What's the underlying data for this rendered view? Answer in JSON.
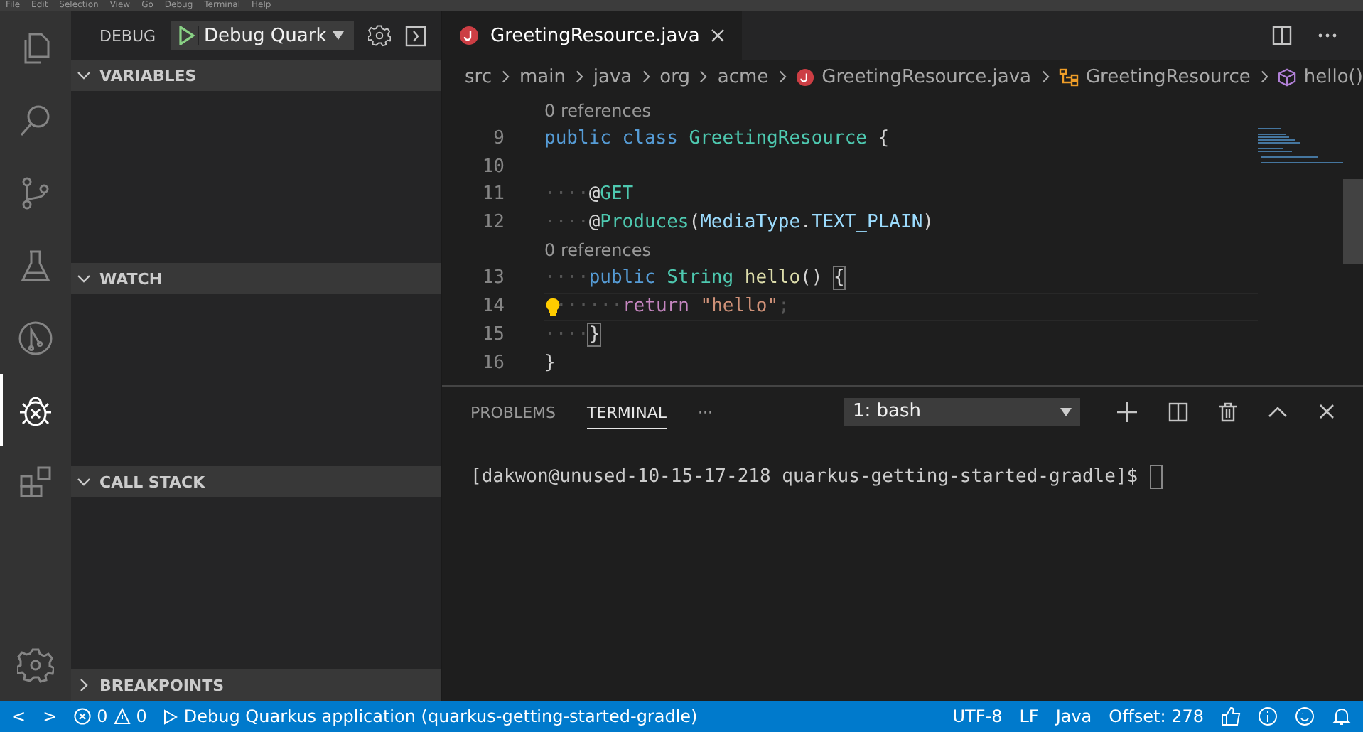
{
  "menu_bar": [
    "File",
    "Edit",
    "Selection",
    "View",
    "Go",
    "Debug",
    "Terminal",
    "Help"
  ],
  "activity_bar": [
    {
      "kind": "files",
      "selected": false
    },
    {
      "kind": "search",
      "selected": false
    },
    {
      "kind": "branch",
      "selected": false
    },
    {
      "kind": "flask",
      "selected": false
    },
    {
      "kind": "graph",
      "selected": false
    },
    {
      "kind": "bug",
      "selected": true
    },
    {
      "kind": "blocks",
      "selected": false
    }
  ],
  "debug_toolbar": {
    "title": "DEBUG",
    "configuration": "Debug Quark"
  },
  "sidebar_sections": [
    {
      "title": "VARIABLES",
      "expanded": true
    },
    {
      "title": "WATCH",
      "expanded": true
    },
    {
      "title": "CALL STACK",
      "expanded": true
    },
    {
      "title": "BREAKPOINTS",
      "expanded": false
    }
  ],
  "editor_tabs": [
    {
      "label": "GreetingResource.java",
      "selected": true
    }
  ],
  "breadcrumbs": [
    {
      "label": "src",
      "kind": "folder"
    },
    {
      "label": "main",
      "kind": "folder"
    },
    {
      "label": "java",
      "kind": "folder"
    },
    {
      "label": "org",
      "kind": "folder"
    },
    {
      "label": "acme",
      "kind": "folder"
    },
    {
      "label": "GreetingResource.java",
      "kind": "java"
    },
    {
      "label": "GreetingResource",
      "kind": "class"
    },
    {
      "label": "hello()",
      "kind": "method"
    }
  ],
  "code_lines": [
    {
      "kind": "lens",
      "text": "0 references"
    },
    {
      "kind": "code",
      "number": "9",
      "current": false,
      "lightbulb": false,
      "tokens": [
        {
          "kind": "kw",
          "text": "public class "
        },
        {
          "kind": "type",
          "text": "GreetingResource"
        },
        {
          "kind": "plain",
          "text": " {"
        }
      ]
    },
    {
      "kind": "code",
      "number": "10",
      "current": false,
      "lightbulb": false
    },
    {
      "kind": "code",
      "number": "11",
      "current": false,
      "lightbulb": false,
      "tokens": [
        {
          "kind": "ws",
          "text": "····"
        },
        {
          "kind": "plain",
          "text": "@"
        },
        {
          "kind": "type",
          "text": "GET"
        }
      ]
    },
    {
      "kind": "code",
      "number": "12",
      "current": false,
      "lightbulb": false,
      "tokens": [
        {
          "kind": "ws",
          "text": "····"
        },
        {
          "kind": "plain",
          "text": "@"
        },
        {
          "kind": "type",
          "text": "Produces"
        },
        {
          "kind": "plain",
          "text": "("
        },
        {
          "kind": "var",
          "text": "MediaType"
        },
        {
          "kind": "plain",
          "text": "."
        },
        {
          "kind": "var",
          "text": "TEXT_PLAIN"
        },
        {
          "kind": "plain",
          "text": ")"
        }
      ]
    },
    {
      "kind": "lens",
      "text": "0 references"
    },
    {
      "kind": "code",
      "number": "13",
      "current": false,
      "lightbulb": false,
      "tokens": [
        {
          "kind": "ws",
          "text": "····"
        },
        {
          "kind": "kw",
          "text": "public "
        },
        {
          "kind": "type",
          "text": "String "
        },
        {
          "kind": "func",
          "text": "hello"
        },
        {
          "kind": "plain",
          "text": "() "
        },
        {
          "kind": "bracket",
          "text": "{"
        }
      ]
    },
    {
      "kind": "code",
      "number": "14",
      "current": true,
      "lightbulb": true,
      "tokens": [
        {
          "kind": "ws",
          "text": "······"
        },
        {
          "kind": "ctrl",
          "text": "return "
        },
        {
          "kind": "str",
          "text": "\"hello\""
        },
        {
          "kind": "ws",
          "text": ";"
        }
      ]
    },
    {
      "kind": "code",
      "number": "15",
      "current": false,
      "lightbulb": false,
      "tokens": [
        {
          "kind": "ws",
          "text": "····"
        },
        {
          "kind": "bracket",
          "text": "}"
        }
      ]
    },
    {
      "kind": "code",
      "number": "16",
      "current": false,
      "lightbulb": false,
      "tokens": [
        {
          "kind": "plain",
          "text": "}"
        }
      ]
    }
  ],
  "panel": {
    "tabs": [
      {
        "label": "PROBLEMS",
        "selected": false
      },
      {
        "label": "TERMINAL",
        "selected": true
      },
      {
        "label": "···",
        "selected": false
      }
    ],
    "terminal_select": "1: bash",
    "terminal_line": "[dakwon@unused-10-15-17-218 quarkus-getting-started-gradle]$"
  },
  "status_bar": {
    "nav_back": "<",
    "nav_forward": ">",
    "errors": "0",
    "warnings": "0",
    "debug_target": "Debug Quarkus application (quarkus-getting-started-gradle)",
    "right": [
      "UTF-8",
      "LF",
      "Java",
      "Offset: 278"
    ]
  }
}
